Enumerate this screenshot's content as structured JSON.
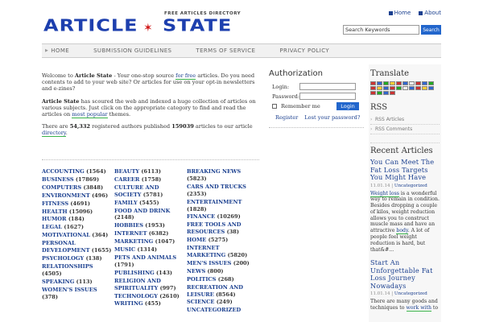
{
  "header": {
    "tagline": "FREE ARTICLES DIRECTORY",
    "logo_word1": "ARTICLE",
    "logo_word2": "STATE",
    "top_links": [
      "Home",
      "About"
    ],
    "search_placeholder": "Search Keywords",
    "search_button": "Search"
  },
  "nav": [
    "HOME",
    "SUBMISSION GUIDELINES",
    "TERMS OF SERVICE",
    "PRIVACY POLICY"
  ],
  "intro": {
    "p1_a": "Welcome to ",
    "p1_b": "Article State",
    "p1_c": " - Your one-stop source ",
    "p1_link": "for free",
    "p1_d": " articles. Do you need contents to add to your web site? Or articles for use on your opt-in newsletters and e-zines?",
    "p2_a": "Article State",
    "p2_b": " has scoured the web and indexed a huge collection of articles on various subjects. Just click on the appropriate category to find and read the articles on ",
    "p2_link": "most popular",
    "p2_c": " themes.",
    "p3_a": "There are ",
    "p3_authors": "54,332",
    "p3_b": " registered authors published ",
    "p3_articles": "159039",
    "p3_c": " articles to our article ",
    "p3_link": "directory",
    "p3_d": "."
  },
  "categories": [
    [
      {
        "name": "ACCOUNTING",
        "count": "(1564)"
      },
      {
        "name": "BUSINESS",
        "count": "(17869)"
      },
      {
        "name": "COMPUTERS",
        "count": "(3848)"
      },
      {
        "name": "ENVIRONMENT",
        "count": "(496)"
      },
      {
        "name": "FITNESS",
        "count": "(4691)"
      },
      {
        "name": "HEALTH",
        "count": "(15096)"
      },
      {
        "name": "HUMOR",
        "count": "(184)"
      },
      {
        "name": "LEGAL",
        "count": "(1627)"
      },
      {
        "name": "MOTIVATIONAL",
        "count": "(364)"
      },
      {
        "name": "PERSONAL DEVELOPMENT",
        "count": "(1655)"
      },
      {
        "name": "PSYCHOLOGY",
        "count": "(138)"
      },
      {
        "name": "RELATIONSHIPS",
        "count": "(4505)"
      },
      {
        "name": "SPEAKING",
        "count": "(113)"
      },
      {
        "name": "WOMEN'S ISSUES",
        "count": "(378)"
      }
    ],
    [
      {
        "name": "BEAUTY",
        "count": "(6113)"
      },
      {
        "name": "CAREER",
        "count": "(1758)"
      },
      {
        "name": "CULTURE AND SOCIETY",
        "count": "(5781)"
      },
      {
        "name": "FAMILY",
        "count": "(5455)"
      },
      {
        "name": "FOOD AND DRINK",
        "count": "(2148)"
      },
      {
        "name": "HOBBIES",
        "count": "(1953)"
      },
      {
        "name": "INTERNET",
        "count": "(6382)"
      },
      {
        "name": "MARKETING",
        "count": "(1047)"
      },
      {
        "name": "MUSIC",
        "count": "(1314)"
      },
      {
        "name": "PETS AND ANIMALS",
        "count": "(1791)"
      },
      {
        "name": "PUBLISHING",
        "count": "(143)"
      },
      {
        "name": "RELIGION AND SPIRITUALITY",
        "count": "(997)"
      },
      {
        "name": "TECHNOLOGY",
        "count": "(2610)"
      },
      {
        "name": "WRITING",
        "count": "(455)"
      }
    ],
    [
      {
        "name": "BREAKING NEWS",
        "count": "(5823)"
      },
      {
        "name": "CARS AND TRUCKS",
        "count": "(2353)"
      },
      {
        "name": "ENTERTAINMENT",
        "count": "(1828)"
      },
      {
        "name": "FINANCE",
        "count": "(10269)"
      },
      {
        "name": "FREE TOOLS AND RESOURCES",
        "count": "(38)"
      },
      {
        "name": "HOME",
        "count": "(5275)"
      },
      {
        "name": "INTERNET MARKETING",
        "count": "(5820)"
      },
      {
        "name": "MEN'S ISSUES",
        "count": "(200)"
      },
      {
        "name": "NEWS",
        "count": "(800)"
      },
      {
        "name": "POLITICS",
        "count": "(268)"
      },
      {
        "name": "RECREATION AND LEISURE",
        "count": "(8564)"
      },
      {
        "name": "SCIENCE",
        "count": "(249)"
      },
      {
        "name": "UNCATEGORIZED",
        "count": ""
      }
    ]
  ],
  "auth": {
    "title": "Authorization",
    "login_label": "Login:",
    "password_label": "Password:",
    "remember_label": "Remember me",
    "login_button": "Login",
    "register_link": "Register",
    "lost_link": "Lost your password?"
  },
  "sidebar": {
    "translate_title": "Translate",
    "rss_title": "RSS",
    "rss_items": [
      "RSS Articles",
      "RSS Comments"
    ],
    "recent_title": "Recent Articles",
    "articles": [
      {
        "title": "You Can Meet The Fat Loss Targets You Might Have",
        "date": "11.01.14",
        "category": "Uncategorized",
        "ex_link": "Weight loss",
        "ex_a": " is a wonderful way to remain in condition. Besides dropping a couple of kilos, weight reduction allows you to construct muscle mass and have an attractive ",
        "ex_link2": "body",
        "ex_b": ". A lot of people feel weight reduction is hard, but that&#..."
      },
      {
        "title": "Start An Unforgettable Fat Loss Journey Nowadays",
        "date": "11.01.14",
        "category": "Uncategorized",
        "ex_a": "There are many goods and techniques to ",
        "ex_link": "work with",
        "ex_b": " to"
      }
    ]
  },
  "colors": {
    "brand_blue": "#1d3fae",
    "star_red": "#d01818",
    "button_blue": "#2266cc",
    "link_underline_green": "#3ab34a"
  }
}
